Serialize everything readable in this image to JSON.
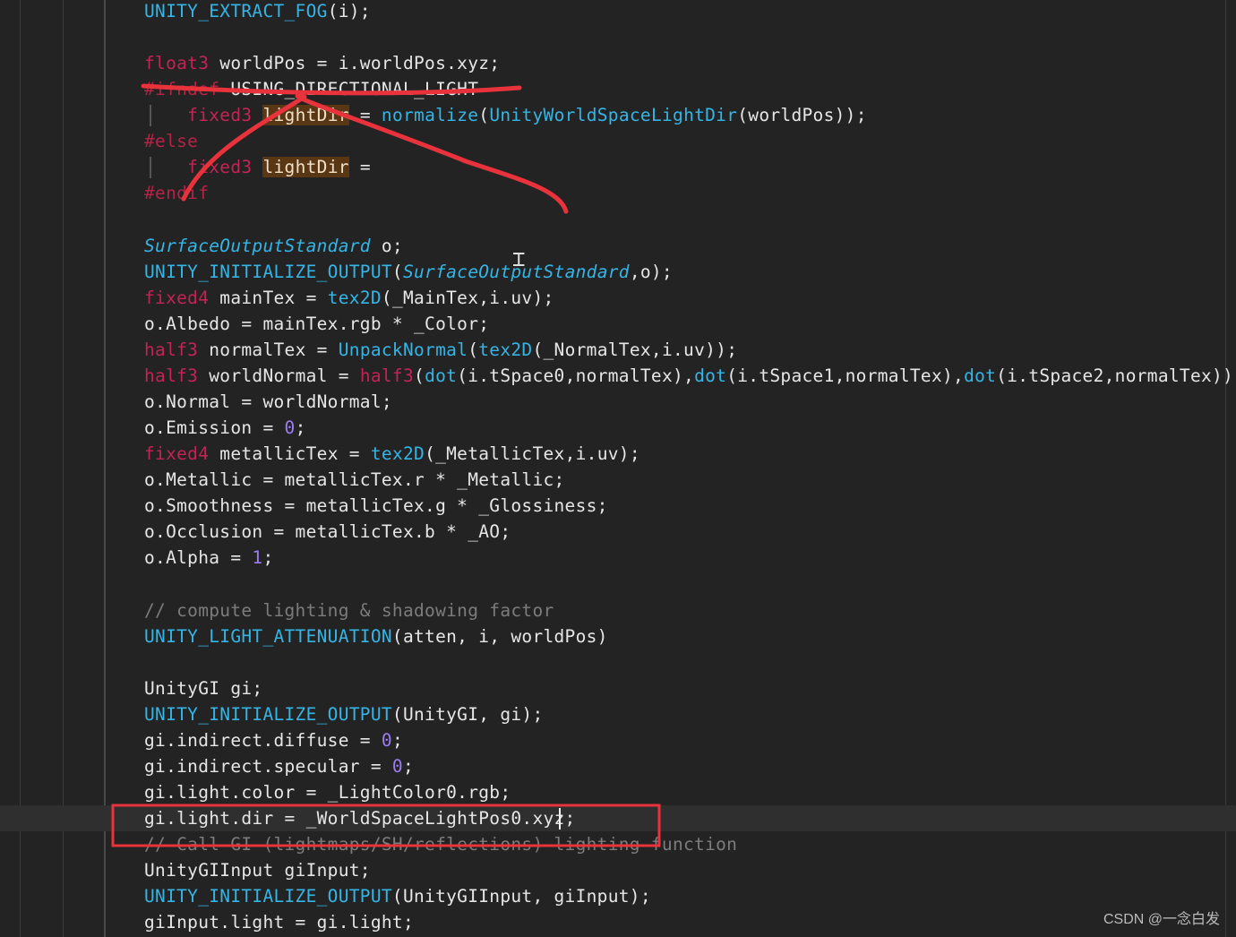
{
  "editor": {
    "lines": [
      {
        "id": "l-extract-fog",
        "tokens": [
          [
            "fn",
            "UNITY_EXTRACT_FOG"
          ],
          [
            "plain",
            "(i);"
          ]
        ]
      },
      {
        "id": "l-blank-1",
        "tokens": []
      },
      {
        "id": "l-worldpos",
        "tokens": [
          [
            "type",
            "float3"
          ],
          [
            "plain",
            " worldPos = i.worldPos.xyz;"
          ]
        ]
      },
      {
        "id": "l-ifndef",
        "tokens": [
          [
            "pp",
            "#ifndef"
          ],
          [
            "plain",
            " USING_DIRECTIONAL_LIGHT"
          ]
        ]
      },
      {
        "id": "l-lightdir-1",
        "tokens": [
          [
            "plain",
            "    "
          ],
          [
            "type",
            "fixed3"
          ],
          [
            "plain",
            " "
          ],
          [
            "hl",
            "lightDir"
          ],
          [
            "plain",
            " = "
          ],
          [
            "fn",
            "normalize"
          ],
          [
            "plain",
            "("
          ],
          [
            "fn",
            "UnityWorldSpaceLightDir"
          ],
          [
            "plain",
            "(worldPos));"
          ]
        ]
      },
      {
        "id": "l-else",
        "tokens": [
          [
            "pp",
            "#else"
          ]
        ]
      },
      {
        "id": "l-lightdir-2",
        "tokens": [
          [
            "plain",
            "    "
          ],
          [
            "type",
            "fixed3"
          ],
          [
            "plain",
            " "
          ],
          [
            "hl",
            "lightDir"
          ],
          [
            "plain",
            " ="
          ]
        ]
      },
      {
        "id": "l-endif",
        "tokens": [
          [
            "pp",
            "#endif"
          ]
        ]
      },
      {
        "id": "l-blank-2",
        "tokens": []
      },
      {
        "id": "l-sos",
        "tokens": [
          [
            "ital",
            "SurfaceOutputStandard"
          ],
          [
            "plain",
            " o;"
          ]
        ]
      },
      {
        "id": "l-init-o",
        "tokens": [
          [
            "fn",
            "UNITY_INITIALIZE_OUTPUT"
          ],
          [
            "plain",
            "("
          ],
          [
            "ital",
            "SurfaceOutputStandard"
          ],
          [
            "plain",
            ",o);"
          ]
        ]
      },
      {
        "id": "l-maintex",
        "tokens": [
          [
            "type",
            "fixed4"
          ],
          [
            "plain",
            " mainTex = "
          ],
          [
            "fn",
            "tex2D"
          ],
          [
            "plain",
            "(_MainTex,i.uv);"
          ]
        ]
      },
      {
        "id": "l-albedo",
        "tokens": [
          [
            "plain",
            "o.Albedo = mainTex.rgb * _Color;"
          ]
        ]
      },
      {
        "id": "l-normaltex",
        "tokens": [
          [
            "type",
            "half3"
          ],
          [
            "plain",
            " normalTex = "
          ],
          [
            "fn",
            "UnpackNormal"
          ],
          [
            "plain",
            "("
          ],
          [
            "fn",
            "tex2D"
          ],
          [
            "plain",
            "(_NormalTex,i.uv));"
          ]
        ]
      },
      {
        "id": "l-worldnormal",
        "tokens": [
          [
            "type",
            "half3"
          ],
          [
            "plain",
            " worldNormal = "
          ],
          [
            "type",
            "half3"
          ],
          [
            "plain",
            "("
          ],
          [
            "fn",
            "dot"
          ],
          [
            "plain",
            "(i.tSpace0,normalTex),"
          ],
          [
            "fn",
            "dot"
          ],
          [
            "plain",
            "(i.tSpace1,normalTex),"
          ],
          [
            "fn",
            "dot"
          ],
          [
            "plain",
            "(i.tSpace2,normalTex));"
          ]
        ]
      },
      {
        "id": "l-normal",
        "tokens": [
          [
            "plain",
            "o.Normal = worldNormal;"
          ]
        ]
      },
      {
        "id": "l-emission",
        "tokens": [
          [
            "plain",
            "o.Emission = "
          ],
          [
            "num",
            "0"
          ],
          [
            "plain",
            ";"
          ]
        ]
      },
      {
        "id": "l-metallictex",
        "tokens": [
          [
            "type",
            "fixed4"
          ],
          [
            "plain",
            " metallicTex = "
          ],
          [
            "fn",
            "tex2D"
          ],
          [
            "plain",
            "(_MetallicTex,i.uv);"
          ]
        ]
      },
      {
        "id": "l-metallic",
        "tokens": [
          [
            "plain",
            "o.Metallic = metallicTex.r * _Metallic;"
          ]
        ]
      },
      {
        "id": "l-smoothness",
        "tokens": [
          [
            "plain",
            "o.Smoothness = metallicTex.g * _Glossiness;"
          ]
        ]
      },
      {
        "id": "l-occlusion",
        "tokens": [
          [
            "plain",
            "o.Occlusion = metallicTex.b * _AO;"
          ]
        ]
      },
      {
        "id": "l-alpha",
        "tokens": [
          [
            "plain",
            "o.Alpha = "
          ],
          [
            "num",
            "1"
          ],
          [
            "plain",
            ";"
          ]
        ]
      },
      {
        "id": "l-blank-3",
        "tokens": []
      },
      {
        "id": "l-comment-1",
        "tokens": [
          [
            "cmt",
            "// compute lighting & shadowing factor"
          ]
        ]
      },
      {
        "id": "l-atten",
        "tokens": [
          [
            "fn",
            "UNITY_LIGHT_ATTENUATION"
          ],
          [
            "plain",
            "(atten, i, worldPos)"
          ]
        ]
      },
      {
        "id": "l-blank-4",
        "tokens": []
      },
      {
        "id": "l-unitygi",
        "tokens": [
          [
            "plain",
            "UnityGI gi;"
          ]
        ]
      },
      {
        "id": "l-init-gi",
        "tokens": [
          [
            "fn",
            "UNITY_INITIALIZE_OUTPUT"
          ],
          [
            "plain",
            "(UnityGI, gi);"
          ]
        ]
      },
      {
        "id": "l-diffuse",
        "tokens": [
          [
            "plain",
            "gi.indirect.diffuse = "
          ],
          [
            "num",
            "0"
          ],
          [
            "plain",
            ";"
          ]
        ]
      },
      {
        "id": "l-specular",
        "tokens": [
          [
            "plain",
            "gi.indirect.specular = "
          ],
          [
            "num",
            "0"
          ],
          [
            "plain",
            ";"
          ]
        ]
      },
      {
        "id": "l-lightcolor",
        "tokens": [
          [
            "plain",
            "gi.light.color = _LightColor0.rgb;"
          ]
        ]
      },
      {
        "id": "l-lightdir-current",
        "tokens": [
          [
            "plain",
            "gi.light.dir = _WorldSpaceLightPos0.xyz;"
          ]
        ]
      },
      {
        "id": "l-comment-2",
        "tokens": [
          [
            "cmt",
            "// Call GI (lightmaps/SH/reflections) lighting function"
          ]
        ]
      },
      {
        "id": "l-giinput",
        "tokens": [
          [
            "plain",
            "UnityGIInput giInput;"
          ]
        ]
      },
      {
        "id": "l-init-giinput",
        "tokens": [
          [
            "fn",
            "UNITY_INITIALIZE_OUTPUT"
          ],
          [
            "plain",
            "(UnityGIInput, giInput);"
          ]
        ]
      },
      {
        "id": "l-giinput-light",
        "tokens": [
          [
            "plain",
            "giInput.light = gi.light;"
          ]
        ]
      }
    ],
    "current_line": 31
  },
  "annotation": {
    "color": "#e8323c",
    "strikeout_lines": [
      "l-ifndef",
      "l-lightdir-1",
      "l-else",
      "l-lightdir-2",
      "l-endif"
    ],
    "boxed_line": "l-lightdir-current"
  },
  "watermark": "CSDN @一念白发",
  "colors": {
    "background": "#232323",
    "keyword": "#e0245e",
    "function": "#34b5e6",
    "number": "#9d7cf0",
    "comment": "#7c7c7c",
    "highlight": "#5a3714"
  }
}
